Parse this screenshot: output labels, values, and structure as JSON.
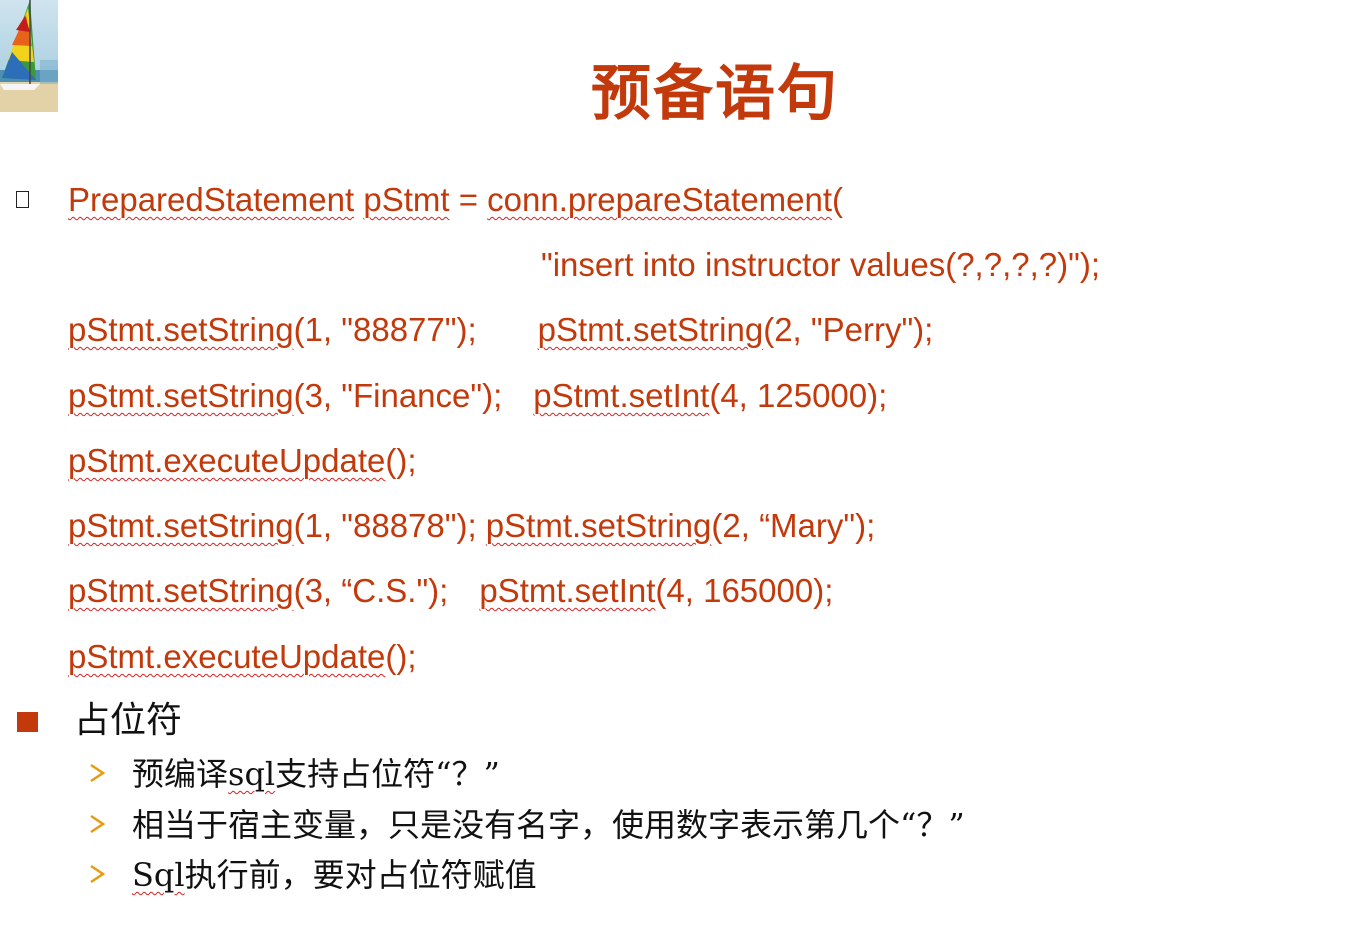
{
  "title": "预备语句",
  "code": {
    "line1": {
      "t1": "PreparedStatement",
      "t2": "pStmt",
      "t3": " = ",
      "t4": "conn.prepareStatement",
      "t5": "("
    },
    "line2": {
      "t1": "\"insert into instructor values(?,?,?,?)\");"
    },
    "line3": {
      "t1": "pStmt.setString",
      "t2": "(1, \"88877\");",
      "t3": "pStmt.setString",
      "t4": "(2, \"Perry\");"
    },
    "line4": {
      "t1": "pStmt.setString",
      "t2": "(3, \"Finance\");",
      "t3": "pStmt.setInt",
      "t4": "(4, 125000);"
    },
    "line5": {
      "t1": "pStmt.executeUpdate",
      "t2": "();"
    },
    "line6": {
      "t1": "pStmt.setString",
      "t2": "(1, \"88878\"); ",
      "t3": "pStmt.setString",
      "t4": "(2, “Mary\");"
    },
    "line7": {
      "t1": "pStmt.setString",
      "t2": "(3, “C.S.\");",
      "t3": "pStmt.setInt",
      "t4": "(4, 165000);"
    },
    "line8": {
      "t1": "pStmt.executeUpdate",
      "t2": "();"
    }
  },
  "bullet": {
    "label": "占位符",
    "sub1": {
      "pre": "预编译",
      "sq": "sql",
      "post": "支持占位符“？”"
    },
    "sub2": {
      "text": "相当于宿主变量，只是没有名字，使用数字表示第几个“？”"
    },
    "sub3": {
      "sq": "Sql",
      "post": "执行前，要对占位符赋值"
    }
  },
  "colors": {
    "accent": "#c23a0c",
    "spellcheck": "#d82020",
    "arrow": "#e89a10"
  },
  "icons": {
    "logo": "sailboat-logo-icon",
    "bullet1": "missing-glyph-bullet-icon",
    "bullet2": "square-bullet-icon",
    "sub": "arrow-bullet-icon"
  }
}
